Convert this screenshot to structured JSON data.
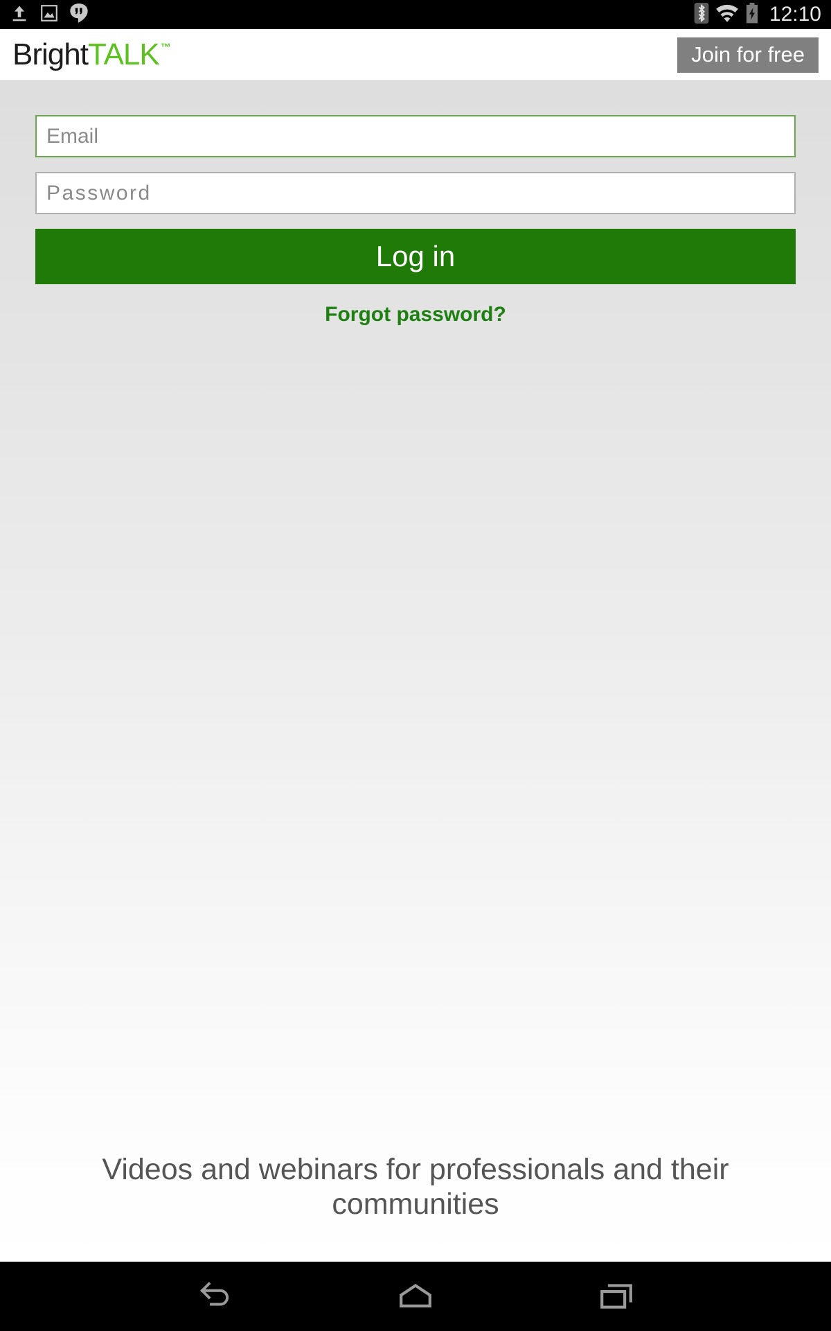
{
  "status_bar": {
    "icons_left": [
      "upload-icon",
      "screenshot-image-icon",
      "hangouts-icon"
    ],
    "icons_right": [
      "bluetooth-icon",
      "wifi-icon",
      "battery-charging-icon"
    ],
    "time": "12:10"
  },
  "header": {
    "logo_part1": "Bright",
    "logo_part2": "TALK",
    "logo_tm": "™",
    "join_label": "Join for free",
    "brand_green": "#5cc220",
    "join_bg": "#808080"
  },
  "form": {
    "email_placeholder": "Email",
    "email_value": "",
    "password_placeholder": "Password",
    "password_value": "",
    "login_label": "Log in",
    "forgot_label": "Forgot password?",
    "login_bg": "#1f7a07",
    "focus_border": "#6aa84f",
    "link_color": "#1e8012"
  },
  "tagline": {
    "text": "Videos and webinars for professionals and their communities"
  },
  "nav_bar": {
    "back": "back-icon",
    "home": "home-icon",
    "recents": "recent-apps-icon"
  }
}
